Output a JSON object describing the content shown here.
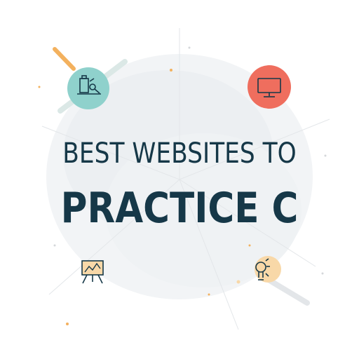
{
  "title": {
    "line1": "BEST WEBSITES TO",
    "line2": "PRACTICE C"
  },
  "colors": {
    "text": "#163848",
    "teal": "#8fd1cc",
    "coral": "#ef6e5e",
    "orange": "#f3b15e",
    "peach": "#f8d8a8",
    "splash": "#eef1f3"
  },
  "icons": {
    "top_left": "lab-desk-icon",
    "top_right": "monitor-icon",
    "bottom_left": "easel-chart-icon",
    "bottom_right": "lightbulb-icon"
  }
}
